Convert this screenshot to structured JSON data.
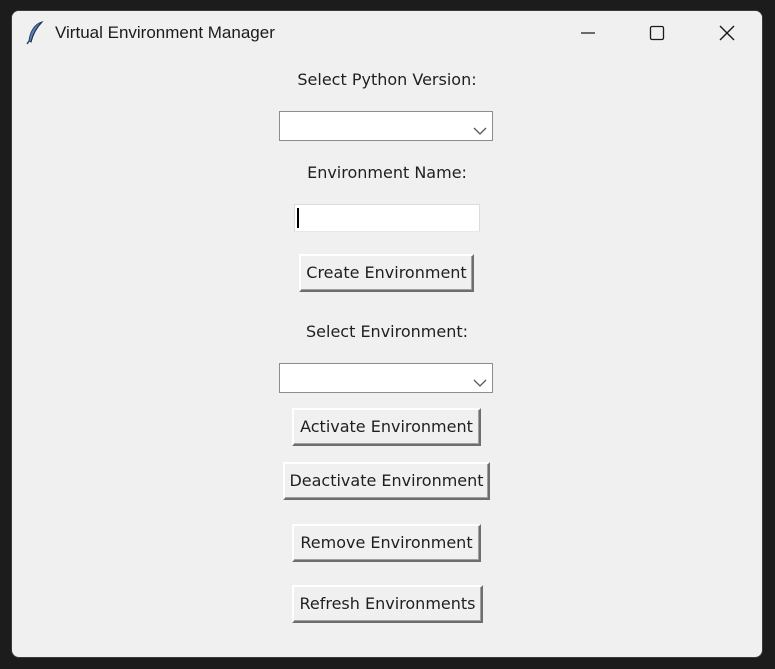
{
  "window": {
    "title": "Virtual Environment Manager",
    "app_icon": "feather-icon",
    "controls": [
      "minimize-icon",
      "maximize-icon",
      "close-icon"
    ]
  },
  "form": {
    "python_version_label": "Select Python Version:",
    "python_version_value": "",
    "env_name_label": "Environment Name:",
    "env_name_value": "",
    "create_button": "Create Environment",
    "select_env_label": "Select Environment:",
    "select_env_value": "",
    "activate_button": "Activate Environment",
    "deactivate_button": "Deactivate Environment",
    "remove_button": "Remove Environment",
    "refresh_button": "Refresh Environments"
  }
}
